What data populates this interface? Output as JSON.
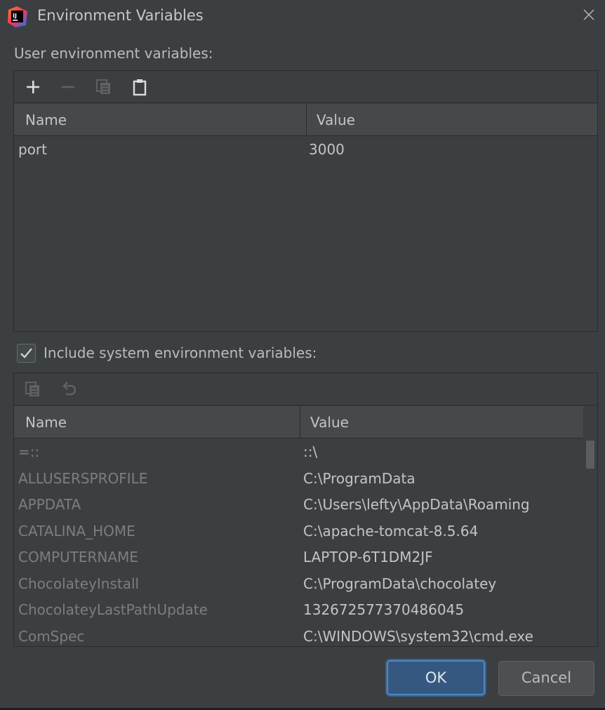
{
  "window": {
    "title": "Environment Variables",
    "icon": "intellij-logo-icon",
    "close_icon": "close-icon"
  },
  "user_section": {
    "label": "User environment variables:",
    "toolbar": [
      "add-icon",
      "remove-icon",
      "copy-icon",
      "paste-icon"
    ],
    "columns": {
      "name": "Name",
      "value": "Value"
    },
    "rows": [
      {
        "name": "port",
        "value": "3000"
      }
    ]
  },
  "system_section": {
    "checkbox_label": "Include system environment variables:",
    "checked": true,
    "toolbar": [
      "copy-icon",
      "undo-icon"
    ],
    "columns": {
      "name": "Name",
      "value": "Value"
    },
    "rows": [
      {
        "name": "=::",
        "value": "::\\"
      },
      {
        "name": "ALLUSERSPROFILE",
        "value": "C:\\ProgramData"
      },
      {
        "name": "APPDATA",
        "value": "C:\\Users\\lefty\\AppData\\Roaming"
      },
      {
        "name": "CATALINA_HOME",
        "value": "C:\\apache-tomcat-8.5.64"
      },
      {
        "name": "COMPUTERNAME",
        "value": "LAPTOP-6T1DM2JF"
      },
      {
        "name": "ChocolateyInstall",
        "value": "C:\\ProgramData\\chocolatey"
      },
      {
        "name": "ChocolateyLastPathUpdate",
        "value": "132672577370486045"
      },
      {
        "name": "ComSpec",
        "value": "C:\\WINDOWS\\system32\\cmd.exe"
      }
    ]
  },
  "buttons": {
    "ok": "OK",
    "cancel": "Cancel"
  },
  "colors": {
    "accent": "#365880",
    "background": "#3c3f41",
    "header": "#45494a"
  }
}
